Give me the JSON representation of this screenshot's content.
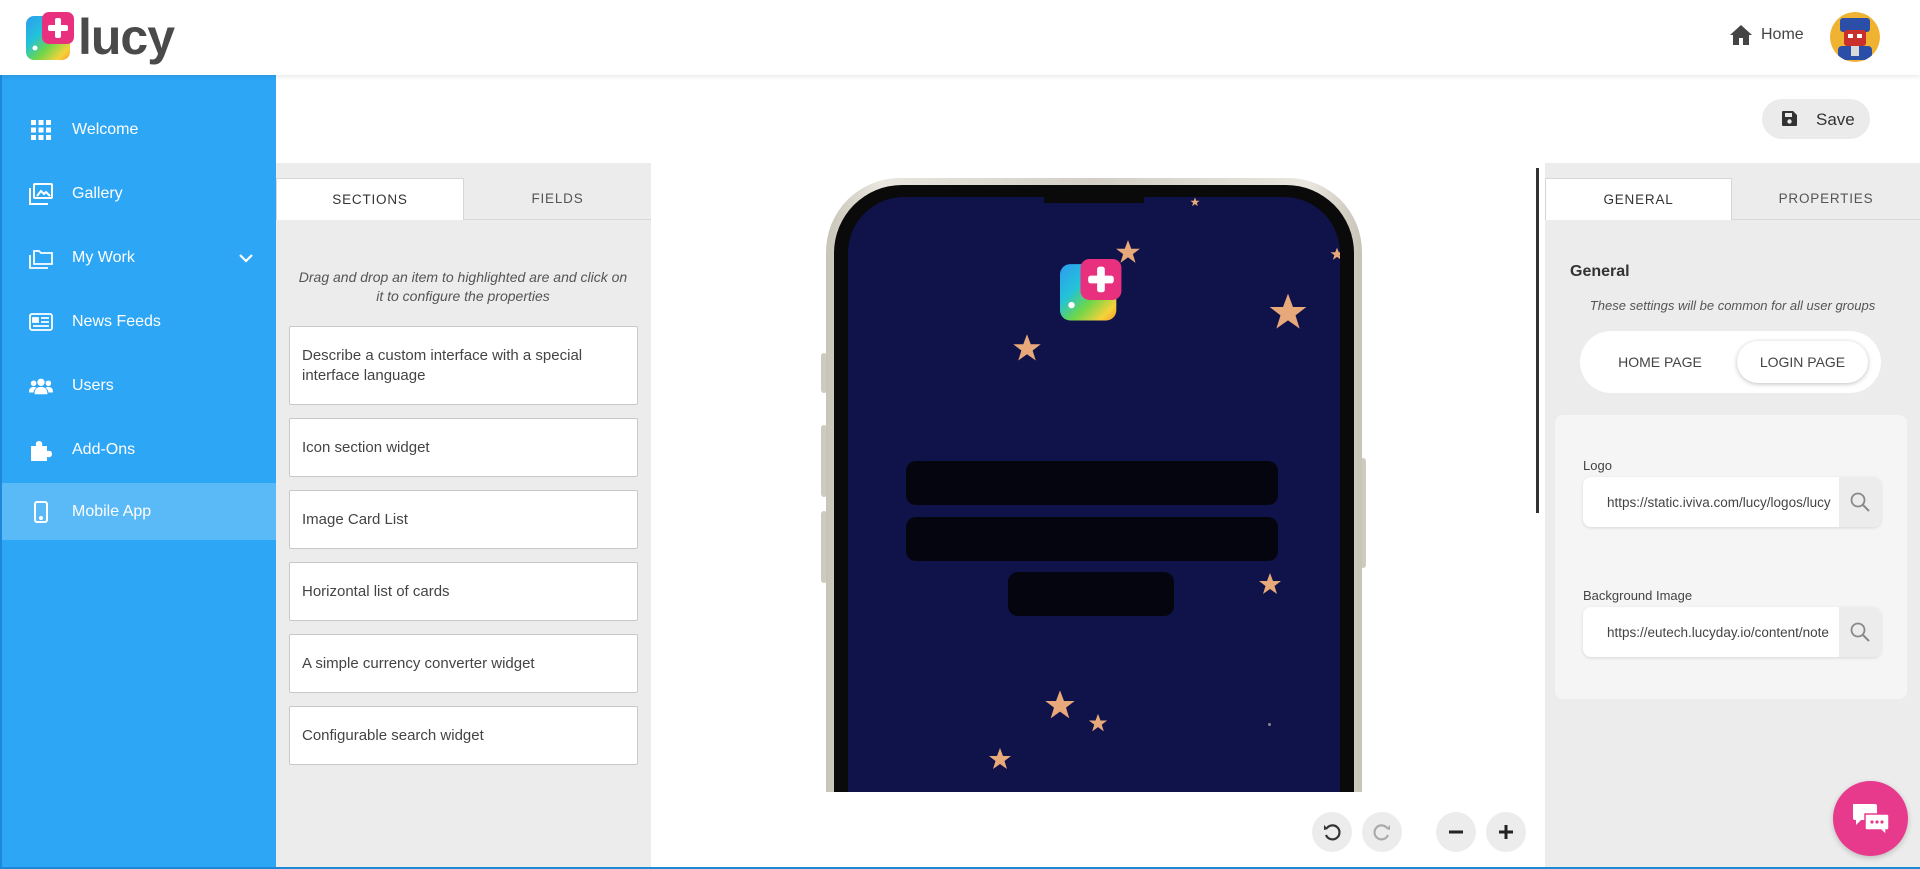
{
  "header": {
    "brand": "lucy",
    "home_label": "Home"
  },
  "sidebar": {
    "items": [
      {
        "label": "Welcome",
        "icon": "grid-icon"
      },
      {
        "label": "Gallery",
        "icon": "gallery-icon"
      },
      {
        "label": "My Work",
        "icon": "folders-icon"
      },
      {
        "label": "News Feeds",
        "icon": "news-icon"
      },
      {
        "label": "Users",
        "icon": "users-icon"
      },
      {
        "label": "Add-Ons",
        "icon": "puzzle-icon"
      },
      {
        "label": "Mobile App",
        "icon": "mobile-icon",
        "active": true
      }
    ]
  },
  "toolbar": {
    "save_label": "Save"
  },
  "left_panel": {
    "tabs": [
      "SECTIONS",
      "FIELDS"
    ],
    "hint": "Drag and drop an item to highlighted are and click on it to configure the properties",
    "widgets": [
      "Describe a custom interface with a special interface language",
      "Icon section widget",
      "Image Card List",
      "Horizontal list of cards",
      "A simple currency converter widget",
      "Configurable search widget"
    ]
  },
  "right_panel": {
    "tabs": [
      "GENERAL",
      "PROPERTIES"
    ],
    "title": "General",
    "note": "These settings will be common for all user groups",
    "segments": [
      "HOME PAGE",
      "LOGIN PAGE"
    ],
    "logo_label": "Logo",
    "logo_value": "https://static.iviva.com/lucy/logos/lucy",
    "bg_label": "Background Image",
    "bg_value": "https://eutech.lucyday.io/content/note"
  },
  "colors": {
    "sidebar": "#2da6f5",
    "sidebar_active": "#5ab9f7",
    "phone_screen": "#10124a",
    "chat": "#e83a8c"
  }
}
